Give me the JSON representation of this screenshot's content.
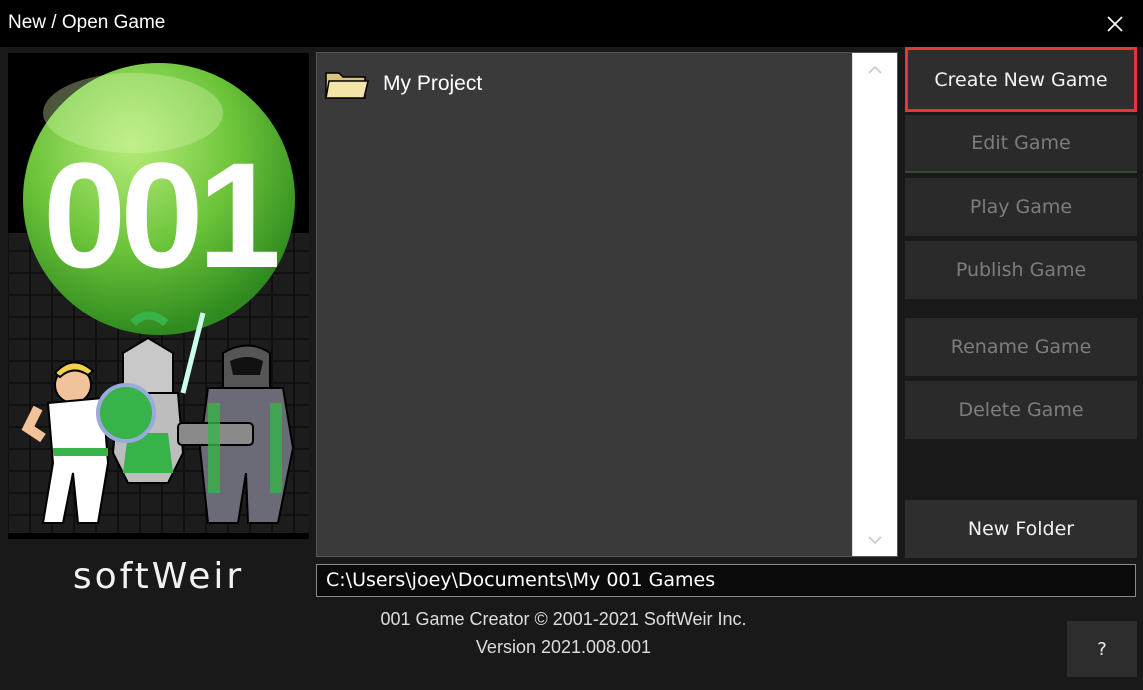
{
  "window": {
    "title": "New / Open Game"
  },
  "logo": {
    "number": "001",
    "brand": "softWeir"
  },
  "games": [
    {
      "name": "My Project"
    }
  ],
  "buttons": {
    "create": "Create New Game",
    "edit": "Edit Game",
    "play": "Play Game",
    "publish": "Publish Game",
    "rename": "Rename Game",
    "delete": "Delete Game",
    "new_folder": "New Folder",
    "help": "?"
  },
  "path": "C:\\Users\\joey\\Documents\\My 001 Games",
  "footer": {
    "copyright": "001 Game Creator © 2001-2021 SoftWeir Inc.",
    "version": "Version 2021.008.001"
  },
  "colors": {
    "highlight": "#e8343b",
    "brand_green": "#6cc43a",
    "panel": "#3a3a3a"
  }
}
